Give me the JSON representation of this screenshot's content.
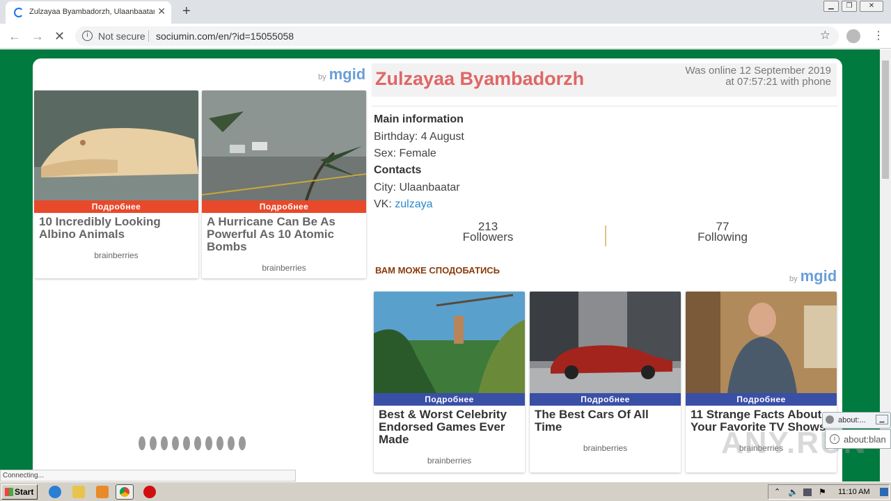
{
  "browser": {
    "tab_title": "Zulzayaa Byambadorzh, Ulaanbaatar",
    "new_tab": "+",
    "security": "Not secure",
    "url": "sociumin.com/en/?id=15055058",
    "status": "Connecting..."
  },
  "ads_left": {
    "brand_by": "by",
    "brand": "mgid",
    "items": [
      {
        "button": "Подробнее",
        "title": "10 Incredibly Looking Albino Animals",
        "source": "brainberries"
      },
      {
        "button": "Подробнее",
        "title": "A Hurricane Can Be As Powerful As 10 Atomic Bombs",
        "source": "brainberries"
      }
    ]
  },
  "profile": {
    "name": "Zulzayaa Byambadorzh",
    "online_line1": "Was online 12 September 2019",
    "online_line2": "at 07:57:21 with phone",
    "main_heading": "Main information",
    "birthday": "Birthday: 4 August",
    "sex": "Sex: Female",
    "contacts_heading": "Contacts",
    "city": "City: Ulaanbaatar",
    "vk_label": "VK: ",
    "vk_link": "zulzaya",
    "followers_count": "213",
    "followers_label": "Followers",
    "following_count": "77",
    "following_label": "Following"
  },
  "ads_right": {
    "heading": "ВАМ МОЖЕ СПОДОБАТИСЬ",
    "brand_by": "by",
    "brand": "mgid",
    "items": [
      {
        "button": "Подробнее",
        "title": "Best & Worst Celebrity Endorsed Games Ever Made",
        "source": "brainberries"
      },
      {
        "button": "Подробнее",
        "title": "The Best Cars Of All Time",
        "source": "brainberries"
      },
      {
        "button": "Подробнее",
        "title": "11 Strange Facts About Your Favorite TV Shows",
        "source": "brainberries"
      }
    ]
  },
  "popups": {
    "first": "about:...",
    "second": "about:blan"
  },
  "watermark": "ANY.RUN",
  "taskbar": {
    "start": "Start",
    "clock": "11:10 AM"
  },
  "colors": {
    "page_bg": "#007a3e",
    "ad_button_left": "#e8492a",
    "ad_button_right": "#3a4fa6",
    "name_color": "#e06666"
  }
}
